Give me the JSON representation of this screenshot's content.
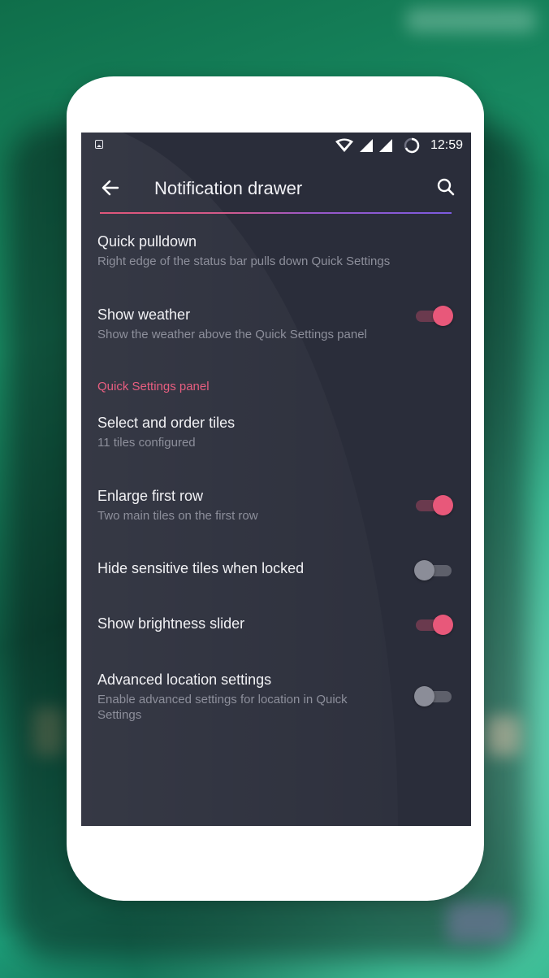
{
  "statusbar": {
    "time": "12:59"
  },
  "toolbar": {
    "title": "Notification drawer"
  },
  "colors": {
    "accent": "#e8587a",
    "screen_bg": "#2a2d3a",
    "section_header": "#e85e80"
  },
  "settings": [
    {
      "title": "Quick pulldown",
      "summary": "Right edge of the status bar pulls down Quick Settings"
    },
    {
      "title": "Show weather",
      "summary": "Show the weather above the Quick Settings panel",
      "toggle": true
    },
    {
      "section_header": "Quick Settings panel"
    },
    {
      "title": "Select and order tiles",
      "summary": "11 tiles configured"
    },
    {
      "title": "Enlarge first row",
      "summary": "Two main tiles on the first row",
      "toggle": true
    },
    {
      "title": "Hide sensitive tiles when locked",
      "toggle": false
    },
    {
      "title": "Show brightness slider",
      "toggle": true
    },
    {
      "title": "Advanced location settings",
      "summary": "Enable advanced settings for location in Quick Settings",
      "toggle": false
    }
  ]
}
